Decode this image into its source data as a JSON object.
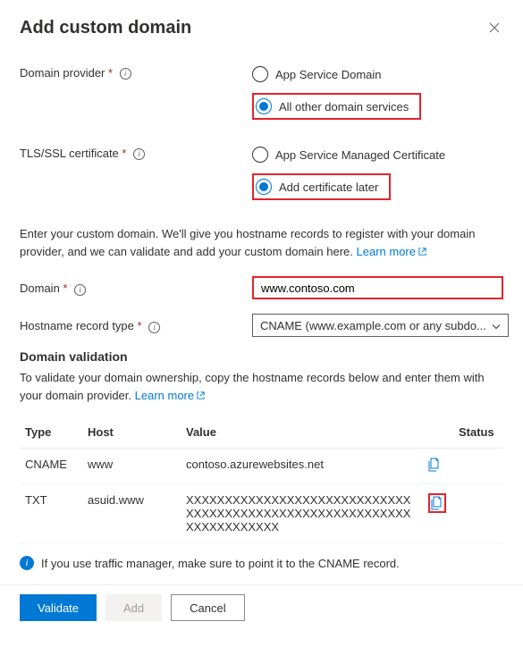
{
  "dialog": {
    "title": "Add custom domain"
  },
  "domainProvider": {
    "label": "Domain provider",
    "options": {
      "appService": "App Service Domain",
      "other": "All other domain services"
    },
    "selected": "other"
  },
  "tlsCert": {
    "label": "TLS/SSL certificate",
    "options": {
      "managed": "App Service Managed Certificate",
      "later": "Add certificate later"
    },
    "selected": "later"
  },
  "domainDesc": {
    "text": "Enter your custom domain. We'll give you hostname records to register with your domain provider, and we can validate and add your custom domain here. ",
    "link": "Learn more"
  },
  "domain": {
    "label": "Domain",
    "value": "www.contoso.com"
  },
  "hostnameType": {
    "label": "Hostname record type",
    "value": "CNAME (www.example.com or any subdo..."
  },
  "validation": {
    "heading": "Domain validation",
    "text": "To validate your domain ownership, copy the hostname records below and enter them with your domain provider. ",
    "link": "Learn more"
  },
  "table": {
    "headers": {
      "type": "Type",
      "host": "Host",
      "value": "Value",
      "status": "Status"
    },
    "rows": [
      {
        "type": "CNAME",
        "host": "www",
        "value": "contoso.azurewebsites.net",
        "hlCopy": false
      },
      {
        "type": "TXT",
        "host": "asuid.www",
        "value": "XXXXXXXXXXXXXXXXXXXXXXXXXXXXXXXXXXXXXXXXXXXXXXXXXXXXXXXXXXXXXXXXXXXXXX",
        "hlCopy": true
      }
    ]
  },
  "notice": "If you use traffic manager, make sure to point it to the CNAME record.",
  "buttons": {
    "validate": "Validate",
    "add": "Add",
    "cancel": "Cancel"
  }
}
